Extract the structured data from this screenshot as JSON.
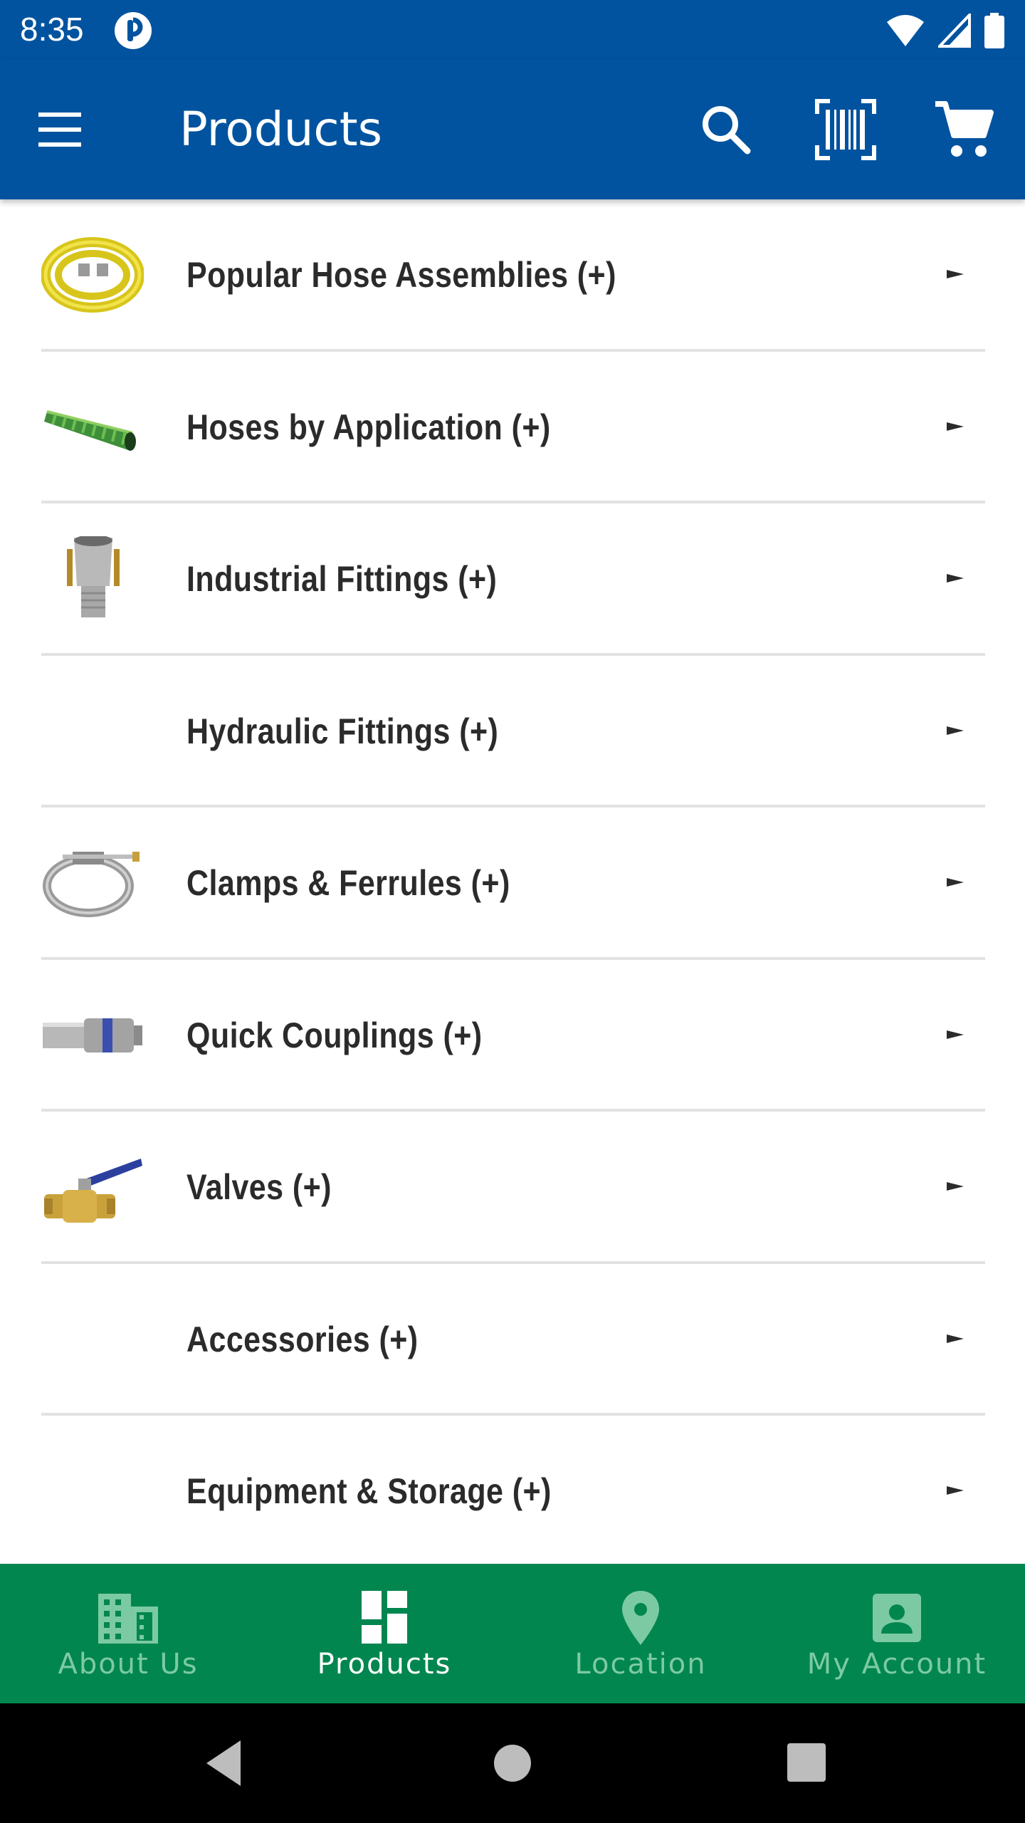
{
  "status_bar": {
    "time": "8:35",
    "icons": [
      "app-notification-icon",
      "wifi-icon",
      "signal-icon",
      "battery-icon"
    ]
  },
  "app_bar": {
    "title": "Products",
    "background": "#01539f",
    "icons": [
      "menu-icon",
      "search-icon",
      "barcode-scan-icon",
      "cart-icon"
    ]
  },
  "products": {
    "items": [
      {
        "label": "Popular Hose Assemblies (+)",
        "thumb": "yellow-hose-coil"
      },
      {
        "label": "Hoses by Application (+)",
        "thumb": "green-suction-hose"
      },
      {
        "label": "Industrial Fittings (+)",
        "thumb": "camlock-fitting"
      },
      {
        "label": "Hydraulic Fittings (+)",
        "thumb": ""
      },
      {
        "label": "Clamps & Ferrules (+)",
        "thumb": "t-bolt-clamp"
      },
      {
        "label": "Quick Couplings (+)",
        "thumb": "quick-coupler"
      },
      {
        "label": "Valves (+)",
        "thumb": "ball-valve"
      },
      {
        "label": "Accessories (+)",
        "thumb": ""
      },
      {
        "label": "Equipment & Storage (+)",
        "thumb": ""
      }
    ]
  },
  "bottom_nav": {
    "background": "#01864f",
    "tabs": [
      {
        "label": "About Us",
        "icon": "building-icon",
        "active": false
      },
      {
        "label": "Products",
        "icon": "dashboard-icon",
        "active": true
      },
      {
        "label": "Location",
        "icon": "location-pin-icon",
        "active": false
      },
      {
        "label": "My Account",
        "icon": "account-box-icon",
        "active": false
      }
    ]
  },
  "system_nav": {
    "buttons": [
      "back-icon",
      "home-icon",
      "recents-icon"
    ]
  }
}
